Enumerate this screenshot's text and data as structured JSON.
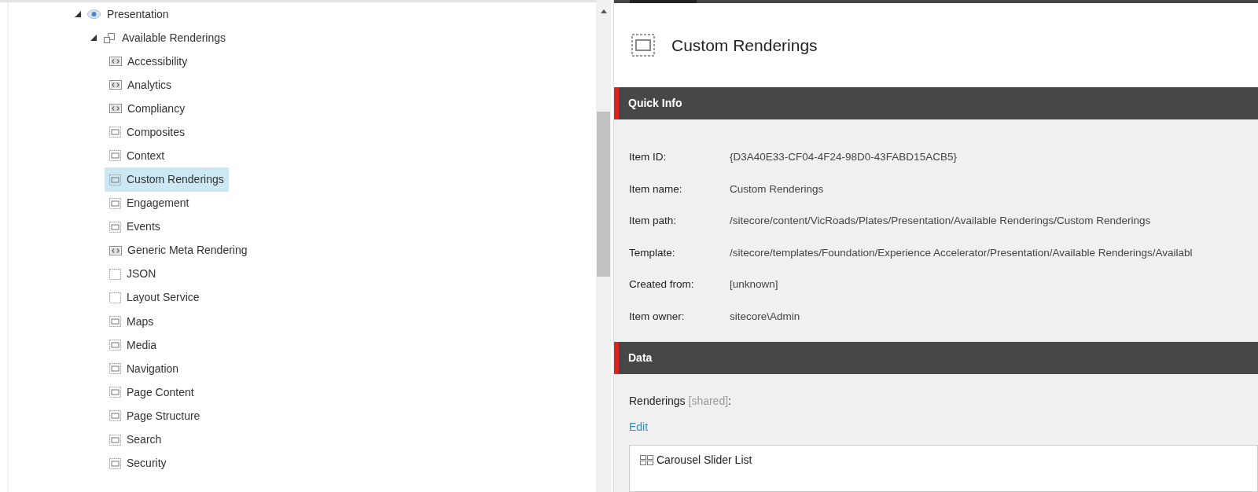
{
  "tree": {
    "label": "Presentation",
    "expanded": true,
    "children": [
      {
        "label": "Available Renderings",
        "expanded": true,
        "children": [
          {
            "label": "Accessibility",
            "kind": "code",
            "selected": false
          },
          {
            "label": "Analytics",
            "kind": "code",
            "selected": false
          },
          {
            "label": "Compliancy",
            "kind": "code",
            "selected": false
          },
          {
            "label": "Composites",
            "kind": "rendering",
            "selected": false
          },
          {
            "label": "Context",
            "kind": "rendering",
            "selected": false
          },
          {
            "label": "Custom Renderings",
            "kind": "rendering",
            "selected": true
          },
          {
            "label": "Engagement",
            "kind": "rendering",
            "selected": false
          },
          {
            "label": "Events",
            "kind": "rendering",
            "selected": false
          },
          {
            "label": "Generic Meta Rendering",
            "kind": "code",
            "selected": false
          },
          {
            "label": "JSON",
            "kind": "empty",
            "selected": false
          },
          {
            "label": "Layout Service",
            "kind": "empty",
            "selected": false
          },
          {
            "label": "Maps",
            "kind": "rendering",
            "selected": false
          },
          {
            "label": "Media",
            "kind": "rendering",
            "selected": false
          },
          {
            "label": "Navigation",
            "kind": "rendering",
            "selected": false
          },
          {
            "label": "Page Content",
            "kind": "rendering",
            "selected": false
          },
          {
            "label": "Page Structure",
            "kind": "rendering",
            "selected": false
          },
          {
            "label": "Search",
            "kind": "rendering",
            "selected": false
          },
          {
            "label": "Security",
            "kind": "rendering",
            "selected": false
          }
        ]
      }
    ]
  },
  "header": {
    "title": "Custom Renderings"
  },
  "quick_info": {
    "title": "Quick Info",
    "fields": [
      {
        "label": "Item ID:",
        "value": "{D3A40E33-CF04-4F24-98D0-43FABD15ACB5}"
      },
      {
        "label": "Item name:",
        "value": "Custom Renderings"
      },
      {
        "label": "Item path:",
        "value": "/sitecore/content/VicRoads/Plates/Presentation/Available Renderings/Custom Renderings"
      },
      {
        "label": "Template:",
        "value": "/sitecore/templates/Foundation/Experience Accelerator/Presentation/Available Renderings/Availabl"
      },
      {
        "label": "Created from:",
        "value": "[unknown]"
      },
      {
        "label": "Item owner:",
        "value": "sitecore\\Admin"
      }
    ]
  },
  "data": {
    "title": "Data",
    "field_label": "Renderings",
    "field_note": "[shared]",
    "field_suffix": ":",
    "edit_link": "Edit",
    "renderings": [
      "Carousel Slider List"
    ]
  }
}
